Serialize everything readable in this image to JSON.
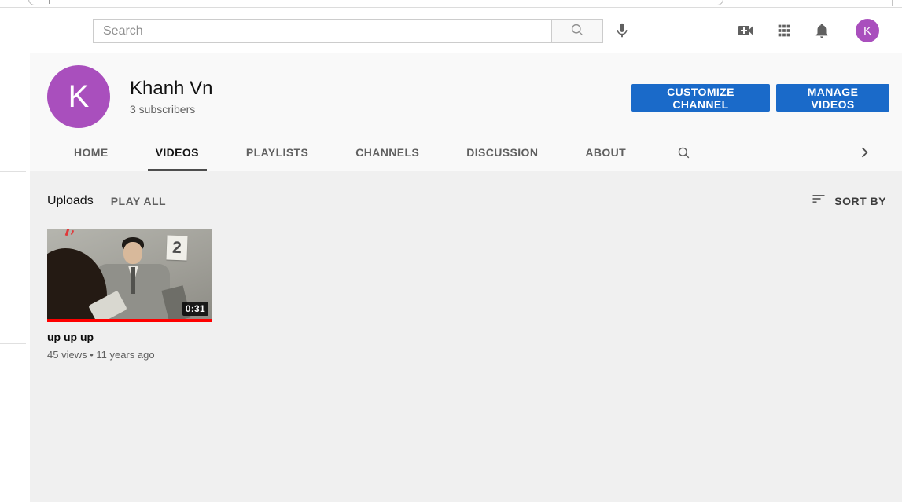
{
  "browser": {
    "address_bar_value": ""
  },
  "masthead": {
    "search_placeholder": "Search",
    "avatar_initial": "K"
  },
  "channel": {
    "avatar_initial": "K",
    "name": "Khanh Vn",
    "subscribers": "3 subscribers",
    "buttons": [
      {
        "label": "CUSTOMIZE CHANNEL"
      },
      {
        "label": "MANAGE VIDEOS"
      }
    ],
    "tabs": [
      {
        "label": "HOME",
        "active": false
      },
      {
        "label": "VIDEOS",
        "active": true
      },
      {
        "label": "PLAYLISTS",
        "active": false
      },
      {
        "label": "CHANNELS",
        "active": false
      },
      {
        "label": "DISCUSSION",
        "active": false
      },
      {
        "label": "ABOUT",
        "active": false
      }
    ]
  },
  "content": {
    "section_title": "Uploads",
    "play_all_label": "PLAY ALL",
    "sort_label": "SORT BY",
    "videos": [
      {
        "title": "up up up",
        "duration": "0:31",
        "meta": "45 views • 11 years ago",
        "thumbnail_sign_number": "2",
        "watched_progress_percent": 100
      }
    ]
  },
  "colors": {
    "accent_blue": "#1a6ac9",
    "avatar_purple": "#a94fbd",
    "progress_red": "#fe0000"
  }
}
